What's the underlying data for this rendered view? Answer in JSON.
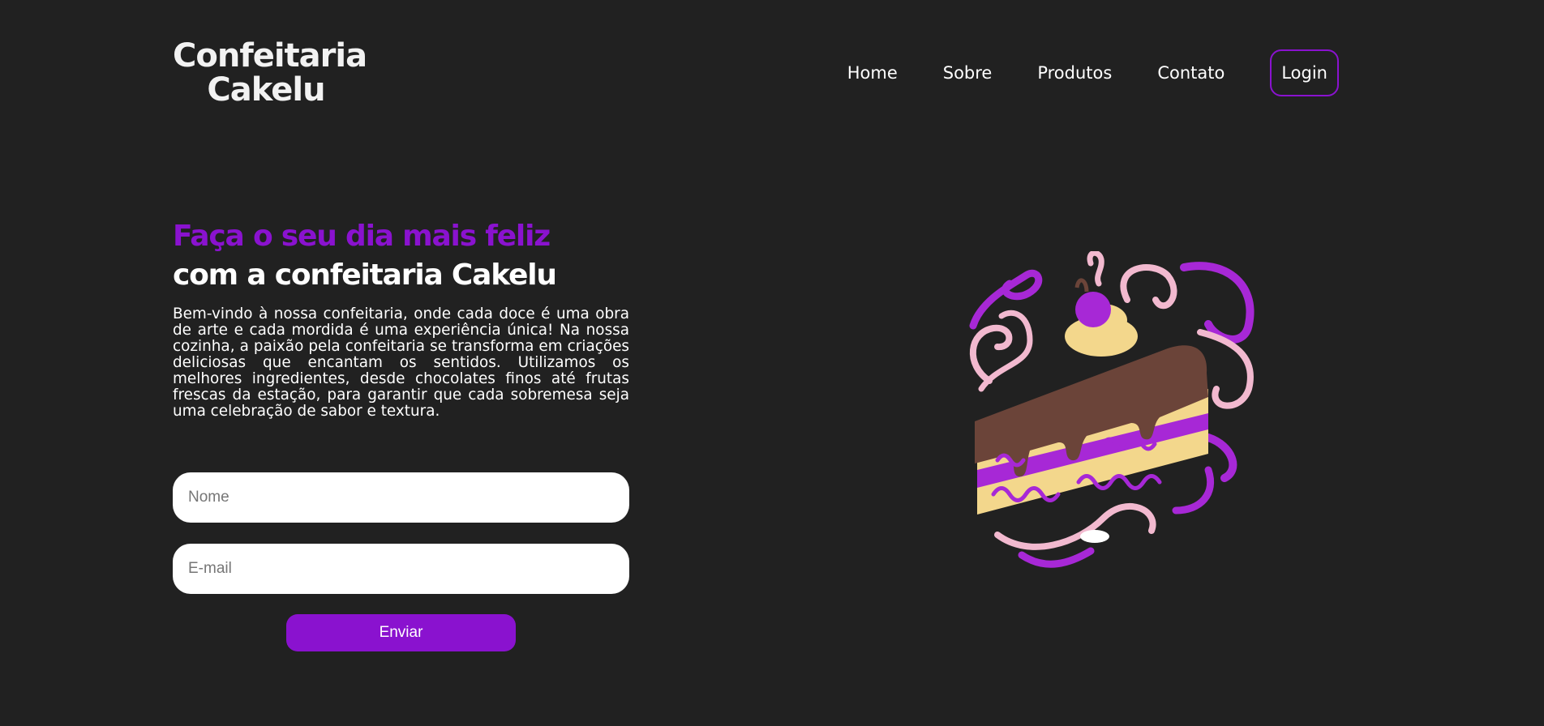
{
  "header": {
    "logo_line1": "Confeitaria",
    "logo_line2": "Cakelu",
    "nav": {
      "home": "Home",
      "sobre": "Sobre",
      "produtos": "Produtos",
      "contato": "Contato",
      "login": "Login"
    }
  },
  "hero": {
    "title_accent": "Faça o seu dia mais feliz",
    "title_main": "com a confeitaria Cakelu",
    "description": "Bem-vindo à nossa confeitaria, onde cada doce é uma obra de arte e cada mordida é uma experiência única! Na nossa cozinha, a paixão pela confeitaria se transforma em criações deliciosas que encantam os sentidos. Utilizamos os melhores ingredientes, desde chocolates finos até frutas frescas da estação, para garantir que cada sobremesa seja uma celebração de sabor e textura."
  },
  "form": {
    "name_placeholder": "Nome",
    "email_placeholder": "E-mail",
    "submit_label": "Enviar"
  },
  "illustration": {
    "icon": "cake-slice-illustration"
  },
  "colors": {
    "background": "#212121",
    "accent": "#8a12cf",
    "text": "#ffffff"
  }
}
